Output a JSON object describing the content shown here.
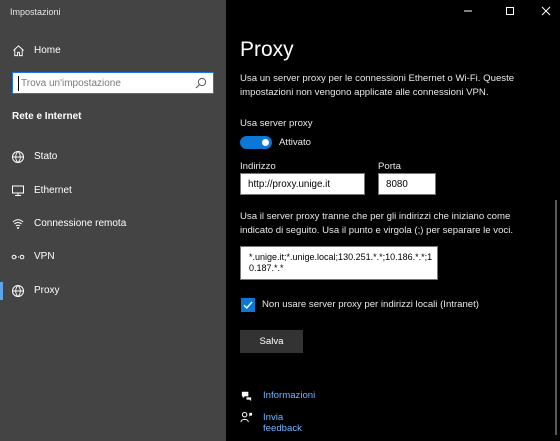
{
  "app": {
    "title": "Impostazioni"
  },
  "sidebar": {
    "home": {
      "label": "Home",
      "icon": "home-icon"
    },
    "search": {
      "placeholder": "Trova un'impostazione",
      "icon": "search-icon"
    },
    "section_title": "Rete e Internet",
    "items": [
      {
        "label": "Stato",
        "icon": "globe-status-icon",
        "active": false
      },
      {
        "label": "Ethernet",
        "icon": "ethernet-icon",
        "active": false
      },
      {
        "label": "Connessione remota",
        "icon": "dial-up-icon",
        "active": false
      },
      {
        "label": "VPN",
        "icon": "vpn-icon",
        "active": false
      },
      {
        "label": "Proxy",
        "icon": "globe-proxy-icon",
        "active": true
      }
    ]
  },
  "main": {
    "heading": "Proxy",
    "description": "Usa un server proxy per le connessioni Ethernet o Wi-Fi. Queste impostazioni non vengono applicate alle connessioni VPN.",
    "use_proxy": {
      "label": "Usa server proxy",
      "state": "Attivato",
      "on": true
    },
    "address": {
      "label": "Indirizzo",
      "value": "http://proxy.unige.it"
    },
    "port": {
      "label": "Porta",
      "value": "8080"
    },
    "exceptions": {
      "description": "Usa il server proxy tranne che per gli indirizzi che iniziano come indicato di seguito. Usa il punto e virgola (;) per separare le voci.",
      "value": "*.unige.it;*.unige.local;130.251.*.*;10.186.*.*;10.187.*.*"
    },
    "local_bypass": {
      "label": "Non usare server proxy per indirizzi locali (Intranet)",
      "checked": true
    },
    "save_label": "Salva",
    "links": [
      {
        "label": "Informazioni",
        "icon": "help-chat-icon"
      },
      {
        "label": "Invia feedback",
        "icon": "feedback-icon"
      }
    ]
  },
  "colors": {
    "accent": "#0a78d4",
    "link": "#6eb5ff",
    "sidebar_bg": "#444444",
    "main_bg": "#000000"
  }
}
